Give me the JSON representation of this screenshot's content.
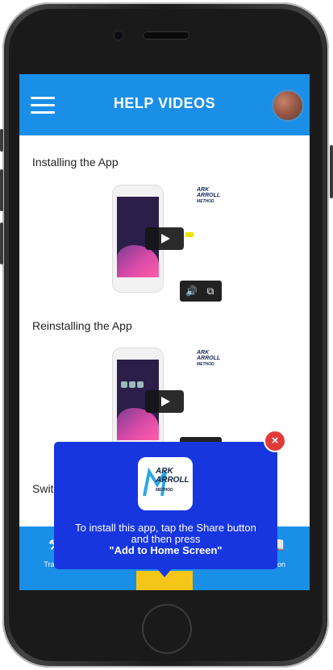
{
  "header": {
    "title": "HELP VIDEOS"
  },
  "sections": [
    {
      "label": "Installing the App"
    },
    {
      "label": "Reinstalling the App"
    },
    {
      "label": "Swit"
    }
  ],
  "nav": {
    "left_label": "Trainin",
    "right_label": "cation"
  },
  "popup": {
    "line1": "To install this app, tap the Share button",
    "line2": "and then press",
    "line3": "\"Add to Home Screen\"",
    "logo_text_top": "ARK",
    "logo_text_bottom": "ARROLL",
    "logo_text_sub": "METHOD"
  },
  "video_logo": {
    "line1": "ARK",
    "line2": "ARROLL",
    "line3": "METHOD"
  },
  "colors": {
    "header_blue": "#1a8fe8",
    "popup_blue": "#1736e0",
    "close_red": "#e03a3a",
    "accent_yellow": "#f5c518"
  }
}
